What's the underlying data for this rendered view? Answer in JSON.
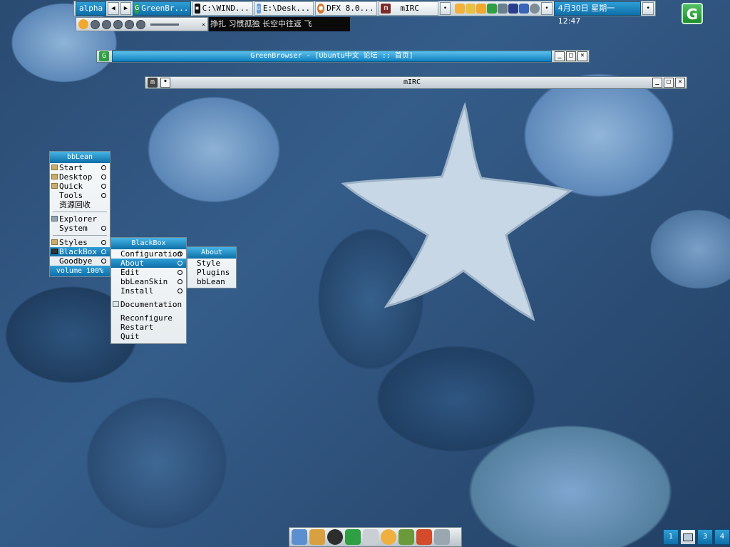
{
  "toolbar": {
    "workspace": "alpha",
    "tasks": [
      {
        "label": "GreenBr...",
        "active": true
      },
      {
        "label": "C:\\WIND..."
      },
      {
        "label": "E:\\Desk..."
      },
      {
        "label": "DFX 8.0..."
      },
      {
        "label": "mIRC"
      }
    ],
    "clock": "4月30日 星期一 12:47"
  },
  "media": {
    "lyrics": "挣扎  习惯孤独  长空中往返  飞"
  },
  "greenbrowser_window": {
    "title": "GreenBrowser - [Ubuntu中文 论坛 :: 首页]"
  },
  "mirc_window": {
    "title": "mIRC"
  },
  "bblean_menu": {
    "title": "bbLean",
    "items": [
      {
        "label": "Start",
        "sub": true
      },
      {
        "label": "Desktop",
        "sub": true
      },
      {
        "label": "Quick",
        "sub": true
      },
      {
        "label": "Tools",
        "sub": true
      },
      {
        "label": "资源回收"
      },
      {
        "label": "Explorer"
      },
      {
        "label": "System",
        "sub": true
      },
      {
        "label": "Styles",
        "sub": true
      },
      {
        "label": "BlackBox",
        "sub": true,
        "selected": true
      },
      {
        "label": "Goodbye",
        "sub": true
      }
    ],
    "footer": "volume 100%"
  },
  "blackbox_menu": {
    "title": "BlackBox",
    "items": [
      {
        "label": "Configuration",
        "sub": true
      },
      {
        "label": "About",
        "sub": true,
        "selected": true
      },
      {
        "label": "Edit",
        "sub": true
      },
      {
        "label": "bbLeanSkin",
        "sub": true
      },
      {
        "label": "Install",
        "sub": true
      },
      {
        "label": "Documentation"
      },
      {
        "label": "Reconfigure"
      },
      {
        "label": "Restart"
      },
      {
        "label": "Quit"
      }
    ]
  },
  "about_menu": {
    "title": "About",
    "items": [
      {
        "label": "Style"
      },
      {
        "label": "Plugins"
      },
      {
        "label": "bbLean"
      }
    ]
  },
  "pager": {
    "desktops": [
      "1",
      "2",
      "3",
      "4"
    ],
    "current": "2"
  },
  "colors": {
    "accent": "#0e6ea8",
    "accent_light": "#2f9ed6",
    "desktop": "#2a4b72"
  }
}
